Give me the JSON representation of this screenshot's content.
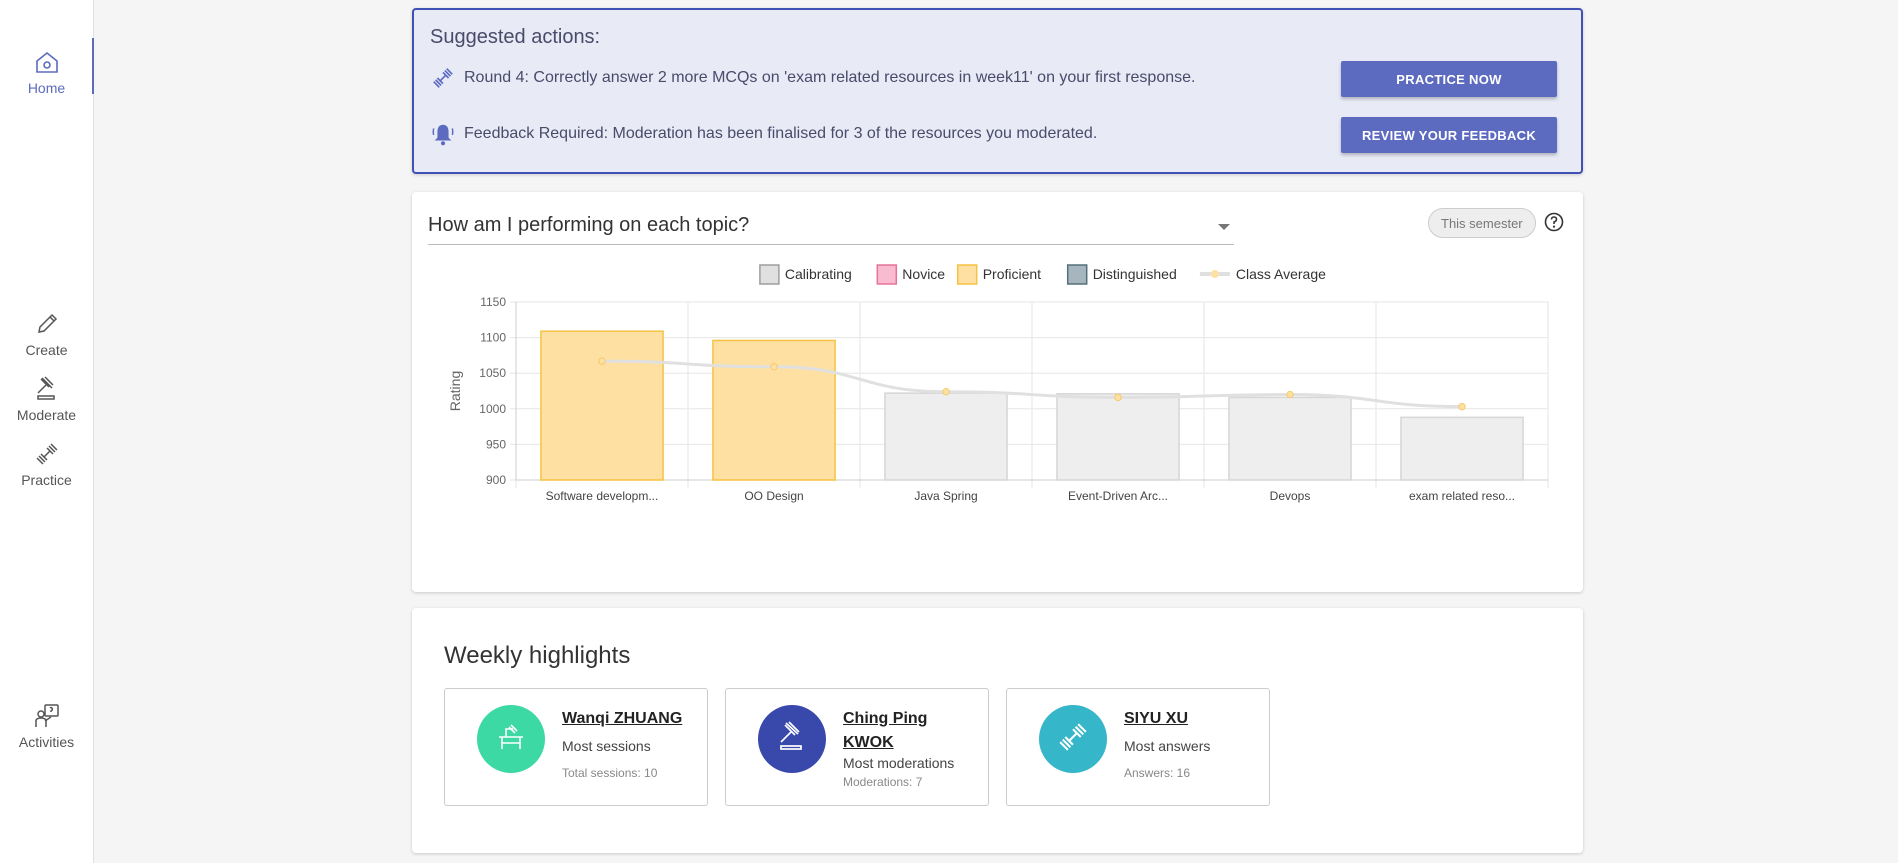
{
  "nav": {
    "home": "Home",
    "create": "Create",
    "moderate": "Moderate",
    "practice": "Practice",
    "activities": "Activities"
  },
  "suggested": {
    "title": "Suggested actions:",
    "items": [
      {
        "icon": "dumbbell-icon",
        "text": "Round 4: Correctly answer 2 more MCQs on 'exam related resources in week11' on your first response.",
        "button": "PRACTICE NOW"
      },
      {
        "icon": "bell-icon",
        "text": "Feedback Required: Moderation has been finalised for 3 of the resources you moderated.",
        "button": "REVIEW YOUR FEEDBACK"
      }
    ]
  },
  "performance": {
    "question": "How am I performing on each topic?",
    "period": "This semester"
  },
  "chart_data": {
    "type": "bar",
    "title": "",
    "xlabel": "",
    "ylabel": "Rating",
    "ylim": [
      900,
      1150
    ],
    "yticks": [
      900,
      950,
      1000,
      1050,
      1100,
      1150
    ],
    "grid": true,
    "legend_position": "top",
    "legend": [
      {
        "name": "Calibrating",
        "fill": "#e0e0e0",
        "stroke": "#9e9e9e"
      },
      {
        "name": "Novice",
        "fill": "#f8bbd0",
        "stroke": "#e57399"
      },
      {
        "name": "Proficient",
        "fill": "#ffe0a3",
        "stroke": "#f5c242"
      },
      {
        "name": "Distinguished",
        "fill": "#a7b6be",
        "stroke": "#546e7a"
      },
      {
        "name": "Class Average",
        "fill": "#ffe0a3",
        "stroke": "#e0e0e0",
        "line": true
      }
    ],
    "categories": [
      "Software developm...",
      "OO Design",
      "Java Spring",
      "Event-Driven Arc...",
      "Devops",
      "exam related reso..."
    ],
    "series": [
      {
        "values": [
          1109,
          1096,
          1022,
          1021,
          1016,
          988
        ],
        "levels": [
          "Proficient",
          "Proficient",
          "Calibrating",
          "Calibrating",
          "Calibrating",
          "Calibrating"
        ]
      },
      {
        "name": "Class Average",
        "values": [
          1067,
          1059,
          1024,
          1016,
          1020,
          1003
        ]
      }
    ]
  },
  "weekly": {
    "title": "Weekly highlights",
    "items": [
      {
        "name": "Wanqi ZHUANG",
        "subtitle": "Most sessions",
        "stat": "Total sessions: 10",
        "color": "#3dd9a4",
        "icon": "desk-icon"
      },
      {
        "name": "Ching Ping KWOK",
        "subtitle": "Most moderations",
        "stat": "Moderations: 7",
        "color": "#3949ab",
        "icon": "gavel-icon"
      },
      {
        "name": "SIYU XU",
        "subtitle": "Most answers",
        "stat": "Answers: 16",
        "color": "#36b6c9",
        "icon": "dumbbell-icon"
      }
    ]
  }
}
